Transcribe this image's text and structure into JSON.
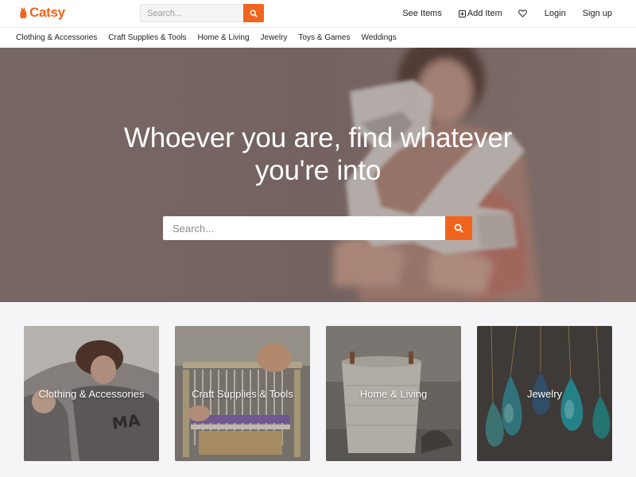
{
  "brand": {
    "name": "Catsy",
    "accent_color": "#f1641e",
    "logo_icon": "cat-silhouette-icon"
  },
  "header": {
    "search_placeholder": "Search...",
    "search_icon": "search-icon",
    "nav": {
      "see_items": "See Items",
      "add_item": "Add Item",
      "add_item_icon": "plus-square-icon",
      "favorites_icon": "heart-icon",
      "login": "Login",
      "signup": "Sign up"
    }
  },
  "categories": [
    "Clothing & Accessories",
    "Craft Supplies & Tools",
    "Home & Living",
    "Jewelry",
    "Toys & Games",
    "Weddings"
  ],
  "hero": {
    "title_line1": "Whoever you are, find whatever",
    "title_line2": "you're into",
    "search_placeholder": "Search...",
    "search_icon": "search-icon"
  },
  "tiles": [
    {
      "label": "Clothing & Accessories"
    },
    {
      "label": "Craft Supplies & Tools"
    },
    {
      "label": "Home & Living"
    },
    {
      "label": "Jewelry"
    }
  ]
}
